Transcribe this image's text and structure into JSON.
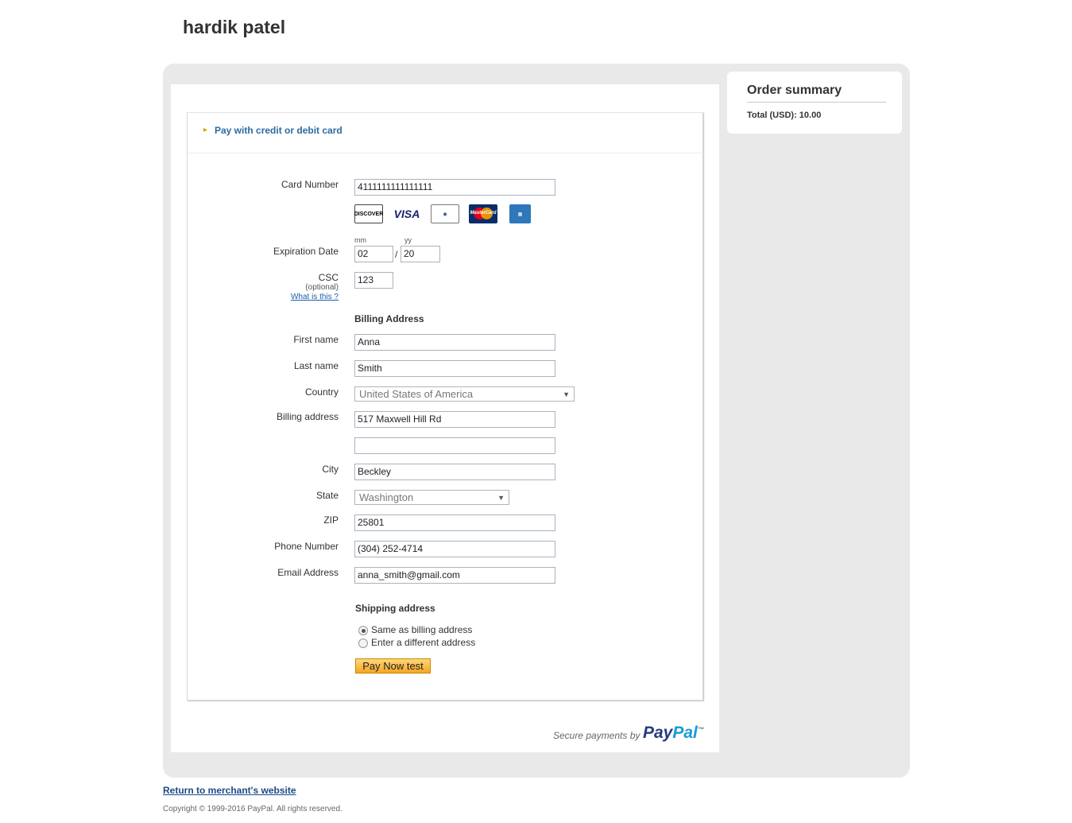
{
  "merchant": {
    "name": "hardik patel"
  },
  "summary": {
    "title": "Order summary",
    "total": "Total (USD): 10.00"
  },
  "payment_method": {
    "label": "Pay with credit or debit card"
  },
  "card": {
    "number_label": "Card Number",
    "number_value": "4111111111111111",
    "brands": [
      "DISCOVER",
      "VISA",
      "Diners Club International",
      "MasterCard",
      "AMERICAN EXPRESS"
    ],
    "expiry_label": "Expiration Date",
    "mm_hint": "mm",
    "yy_hint": "yy",
    "mm_value": "02",
    "separator": "/",
    "yy_value": "20",
    "csc_label": "CSC",
    "csc_optional": "(optional)",
    "csc_help": "What is this ?",
    "csc_value": "123"
  },
  "billing": {
    "heading": "Billing Address",
    "first_name_label": "First name",
    "first_name_value": "Anna",
    "last_name_label": "Last name",
    "last_name_value": "Smith",
    "country_label": "Country",
    "country_value": "United States of America",
    "address_label": "Billing address",
    "address1_value": "517 Maxwell Hill Rd",
    "address2_value": "",
    "city_label": "City",
    "city_value": "Beckley",
    "state_label": "State",
    "state_value": "Washington",
    "zip_label": "ZIP",
    "zip_value": "25801",
    "phone_label": "Phone Number",
    "phone_value": "(304) 252-4714",
    "email_label": "Email Address",
    "email_value": "anna_smith@gmail.com"
  },
  "shipping": {
    "heading": "Shipping address",
    "option_same": "Same as billing address",
    "option_different": "Enter a different address",
    "selected": "same"
  },
  "pay_button": {
    "label": "Pay Now test"
  },
  "footer": {
    "secure_text": "Secure payments by",
    "paypal_part1": "Pay",
    "paypal_part2": "Pal",
    "return_link": "Return to merchant's website",
    "copyright": "Copyright © 1999-2016 PayPal. All rights reserved."
  },
  "colors": {
    "link": "#2c6aa0",
    "button": "#f5a623",
    "paypal_dark": "#253b80",
    "paypal_light": "#179bd7"
  }
}
